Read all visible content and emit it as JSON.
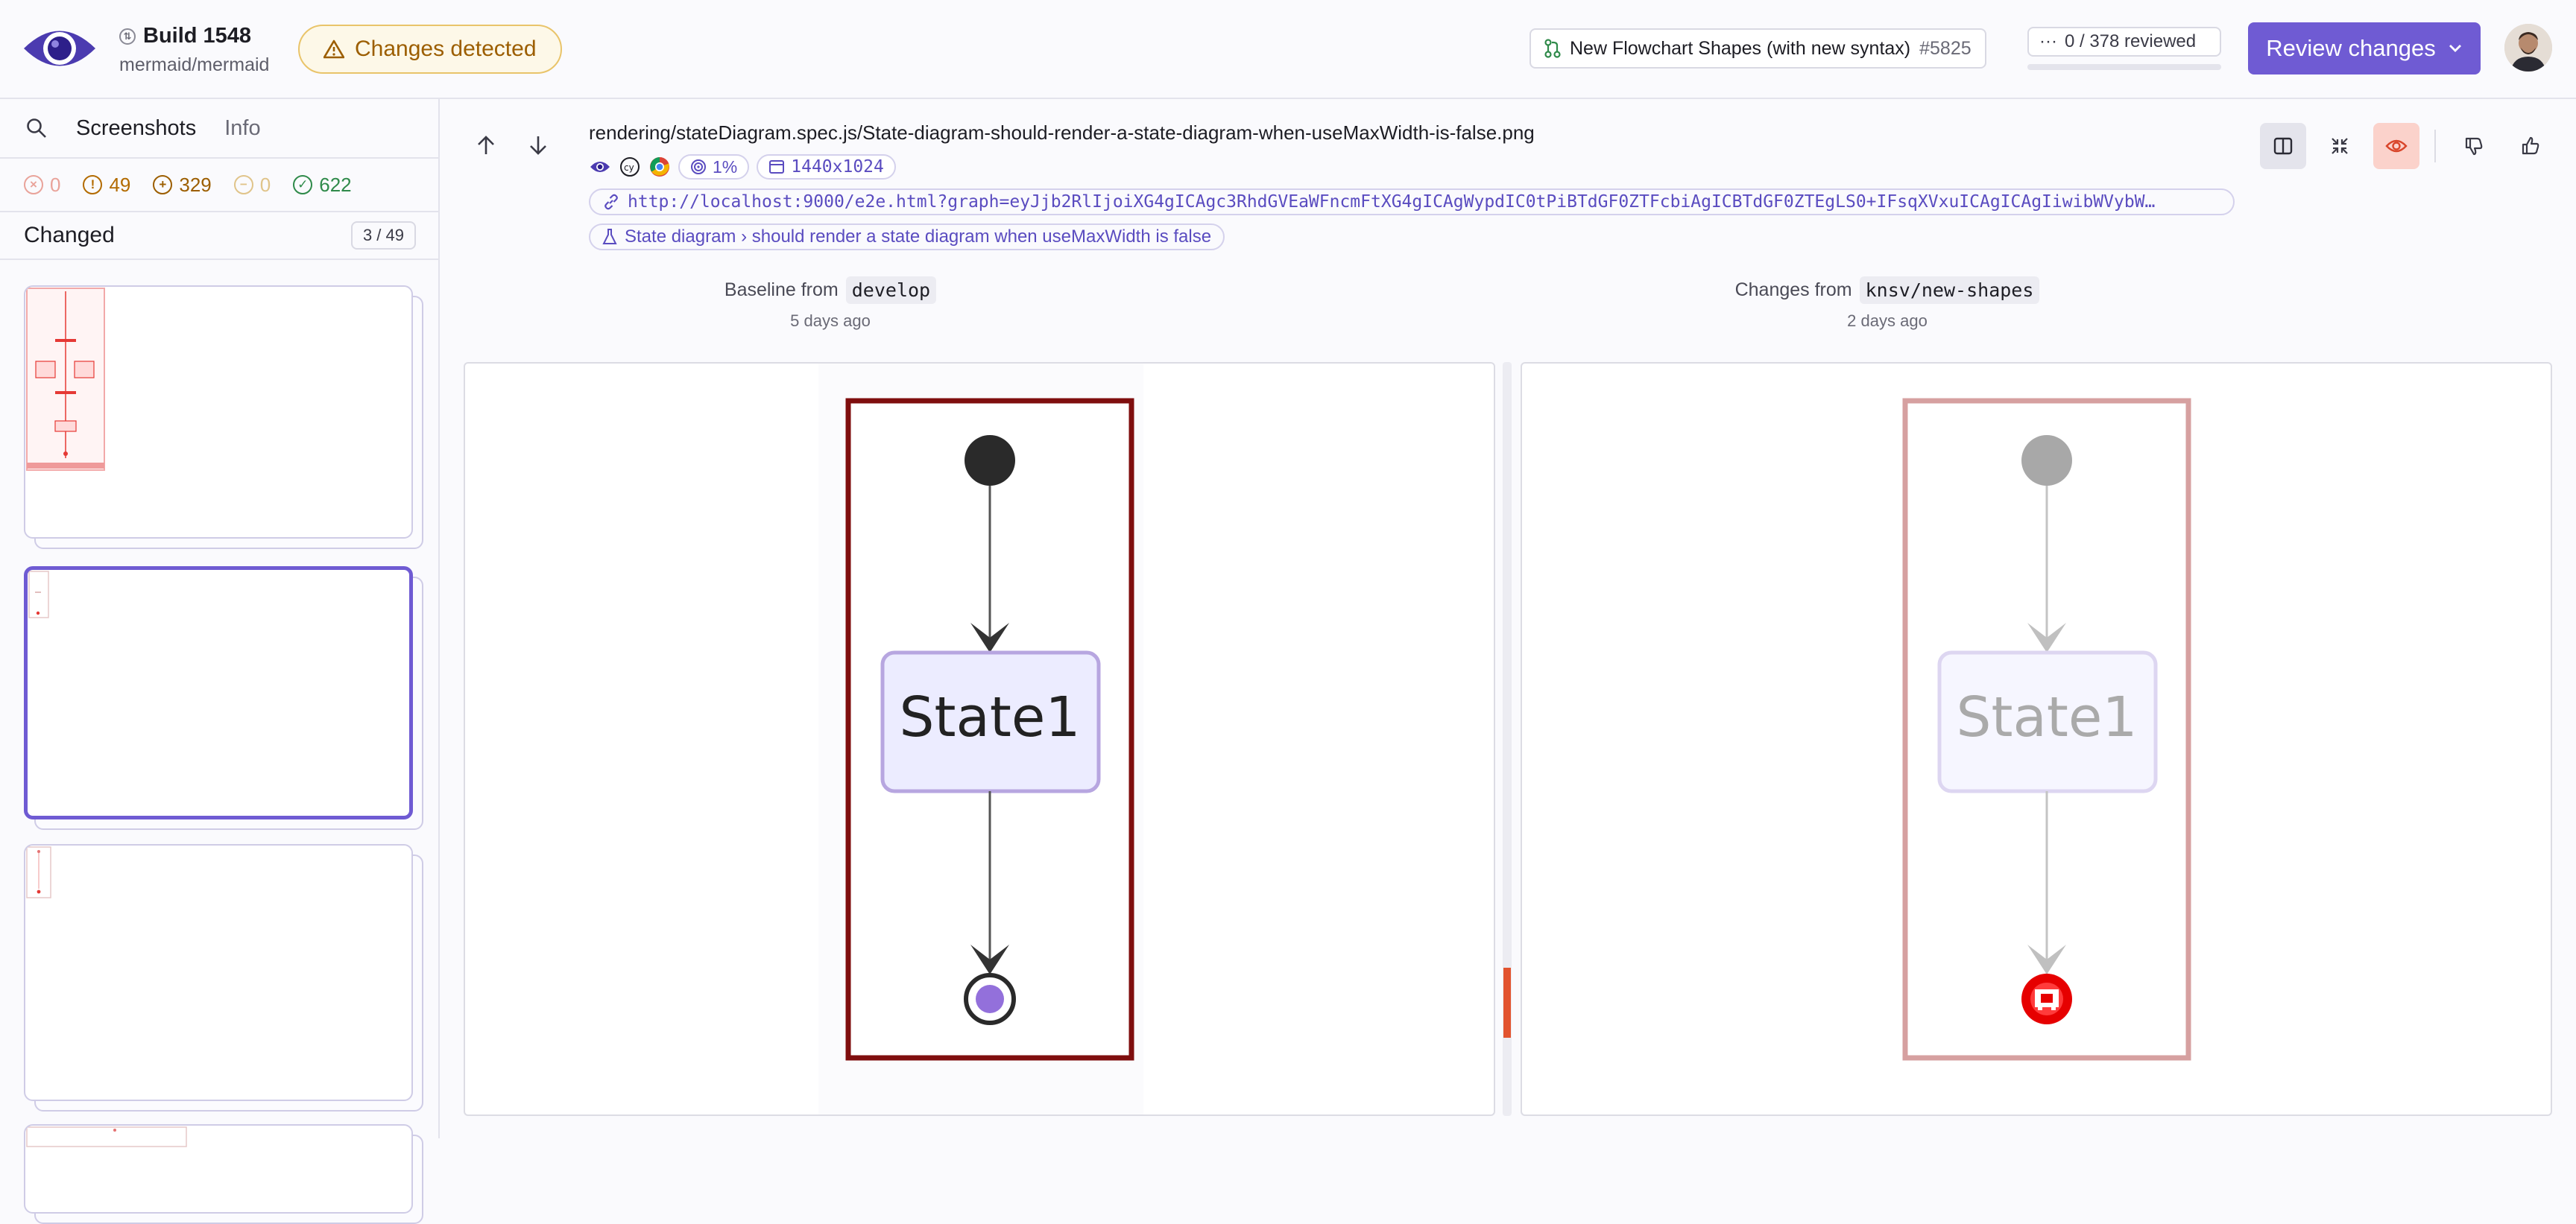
{
  "header": {
    "build_label": "Build 1548",
    "repo": "mermaid/mermaid",
    "status_badge": "Changes detected",
    "pr_title": "New Flowchart Shapes (with new syntax)",
    "pr_number": "#5825",
    "review_count": "0 / 378 reviewed",
    "review_progress": 0,
    "review_button": "Review changes",
    "colors": {
      "accent": "#6f5bd3",
      "warning": "#9c5e00"
    }
  },
  "sidebar": {
    "tabs": [
      "Screenshots",
      "Info"
    ],
    "stats": [
      {
        "icon": "x-circle-icon",
        "value": "0",
        "color": "#e9a39a"
      },
      {
        "icon": "alert-circle-icon",
        "value": "49",
        "color": "#b36b00"
      },
      {
        "icon": "plus-circle-icon",
        "value": "329",
        "color": "#9c5e00"
      },
      {
        "icon": "minus-circle-icon",
        "value": "0",
        "color": "#e0c48a"
      },
      {
        "icon": "check-circle-icon",
        "value": "622",
        "color": "#2f8a4a"
      }
    ],
    "group_title": "Changed",
    "group_count": "3 / 49"
  },
  "main": {
    "filename": "rendering/stateDiagram.spec.js/State-diagram-should-render-a-state-diagram-when-useMaxWidth-is-false.png",
    "threshold": "1%",
    "viewport": "1440x1024",
    "url": "http://localhost:9000/e2e.html?graph=eyJjb2RlIjoiXG4gICAgc3RhdGVEaWFncmFtXG4gICAgWypdIC0tPiBTdGF0ZTFcbiAgICBTdGF0ZTEgLS0+IFsqXVxuICAgICAgIiwibWVybW…",
    "test_title": "State diagram › should render a state diagram when useMaxWidth is false",
    "baseline": {
      "label": "Baseline from",
      "branch": "develop",
      "date": "5 days ago"
    },
    "changes": {
      "label": "Changes from",
      "branch": "knsv/new-shapes",
      "date": "2 days ago"
    },
    "state_label": "State1"
  }
}
